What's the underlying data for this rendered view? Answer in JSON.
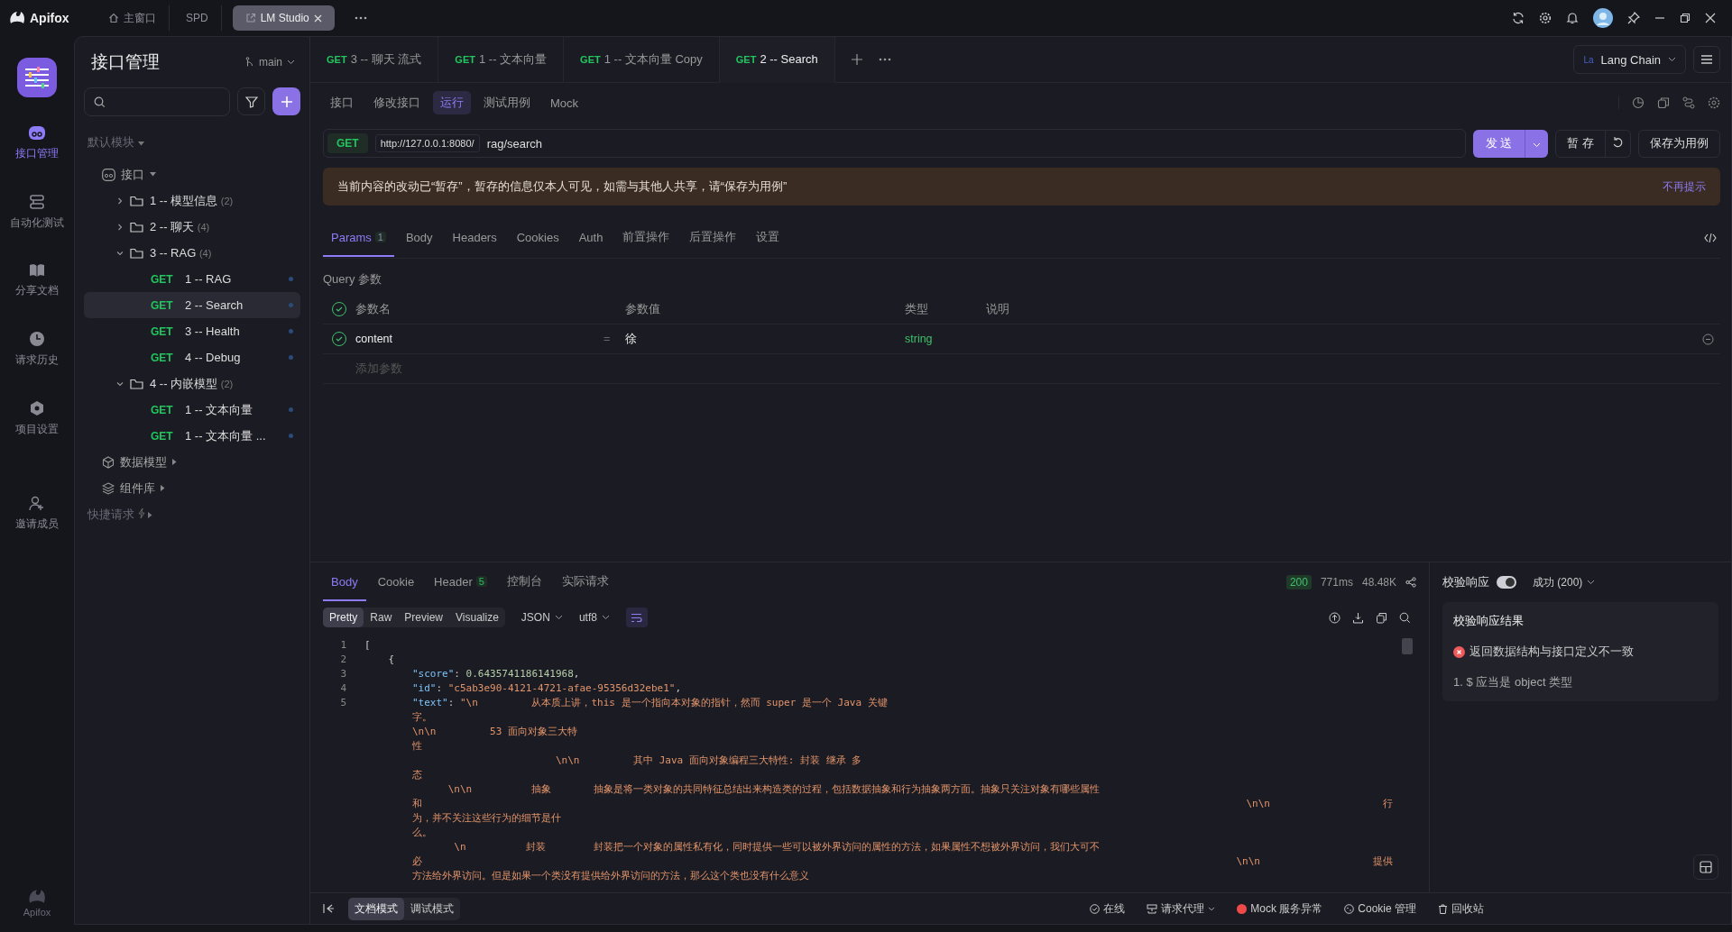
{
  "app": {
    "name": "Apifox"
  },
  "window_tabs": [
    {
      "label": "主窗口",
      "kind": "home",
      "selected": false
    },
    {
      "label": "SPD",
      "kind": "plain",
      "selected": false
    },
    {
      "label": "LM Studio",
      "kind": "external",
      "selected": true
    }
  ],
  "rail": [
    {
      "label": "接口管理",
      "kind": "api",
      "selected": true
    },
    {
      "label": "自动化测试",
      "kind": "auto",
      "selected": false
    },
    {
      "label": "分享文档",
      "kind": "book",
      "selected": false
    },
    {
      "label": "请求历史",
      "kind": "clock",
      "selected": false
    },
    {
      "label": "项目设置",
      "kind": "hex",
      "selected": false
    },
    {
      "label": "邀请成员",
      "kind": "invite",
      "selected": false
    }
  ],
  "rail_footer": "Apifox",
  "sidebar": {
    "title": "接口管理",
    "branch": "main",
    "module": "默认模块",
    "tree": [
      {
        "kind": "root",
        "label": "接口",
        "children": [
          {
            "kind": "folder",
            "label": "1 -- 模型信息",
            "count": "(2)",
            "expanded": false
          },
          {
            "kind": "folder",
            "label": "2 -- 聊天",
            "count": "(4)",
            "expanded": false
          },
          {
            "kind": "folder",
            "label": "3 -- RAG",
            "count": "(4)",
            "expanded": true,
            "children": [
              {
                "kind": "request",
                "method": "GET",
                "label": "1 -- RAG",
                "selected": false
              },
              {
                "kind": "request",
                "method": "GET",
                "label": "2 -- Search",
                "selected": true
              },
              {
                "kind": "request",
                "method": "GET",
                "label": "3 -- Health",
                "selected": false
              },
              {
                "kind": "request",
                "method": "GET",
                "label": "4 -- Debug",
                "selected": false
              }
            ]
          },
          {
            "kind": "folder",
            "label": "4 -- 内嵌模型",
            "count": "(2)",
            "expanded": true,
            "children": [
              {
                "kind": "request",
                "method": "GET",
                "label": "1 -- 文本向量",
                "selected": false
              },
              {
                "kind": "request",
                "method": "GET",
                "label": "1 -- 文本向量 ...",
                "selected": false
              }
            ]
          }
        ]
      }
    ],
    "sections": [
      {
        "label": "数据模型",
        "kind": "cube"
      },
      {
        "label": "组件库",
        "kind": "layers"
      }
    ],
    "quick": "快捷请求"
  },
  "request_tabs": [
    {
      "method": "GET",
      "label": "3 -- 聊天 流式",
      "selected": false
    },
    {
      "method": "GET",
      "label": "1 -- 文本向量",
      "selected": false
    },
    {
      "method": "GET",
      "label": "1 -- 文本向量 Copy",
      "selected": false
    },
    {
      "method": "GET",
      "label": "2 -- Search",
      "selected": true
    }
  ],
  "environment": {
    "badge": "La",
    "name": "Lang Chain"
  },
  "sub_tabs": [
    {
      "label": "接口",
      "selected": false
    },
    {
      "label": "修改接口",
      "selected": false
    },
    {
      "label": "运行",
      "selected": true
    },
    {
      "label": "测试用例",
      "selected": false
    },
    {
      "label": "Mock",
      "selected": false
    }
  ],
  "url": {
    "method": "GET",
    "base": "http://127.0.0.1:8080/",
    "path": "rag/search"
  },
  "buttons": {
    "send": "发 送",
    "save": "暂 存",
    "save_case": "保存为用例"
  },
  "notice": {
    "text": "当前内容的改动已“暂存”，暂存的信息仅本人可见，如需与其他人共享，请“保存为用例”",
    "dismiss": "不再提示"
  },
  "param_tabs": [
    {
      "label": "Params",
      "badge": "1",
      "selected": true
    },
    {
      "label": "Body",
      "selected": false
    },
    {
      "label": "Headers",
      "selected": false
    },
    {
      "label": "Cookies",
      "selected": false
    },
    {
      "label": "Auth",
      "selected": false
    },
    {
      "label": "前置操作",
      "selected": false
    },
    {
      "label": "后置操作",
      "selected": false
    },
    {
      "label": "设置",
      "selected": false
    }
  ],
  "query": {
    "title": "Query 参数",
    "all_checked": true,
    "columns": [
      "参数名",
      "参数值",
      "类型",
      "说明"
    ],
    "rows": [
      {
        "checked": true,
        "name": "content",
        "sep": "=",
        "value": "徐",
        "type": "string"
      }
    ],
    "add": "添加参数"
  },
  "response": {
    "tabs": [
      {
        "label": "Body",
        "selected": true
      },
      {
        "label": "Cookie",
        "selected": false
      },
      {
        "label": "Header",
        "badge": "5",
        "selected": false
      },
      {
        "label": "控制台",
        "selected": false
      },
      {
        "label": "实际请求",
        "selected": false
      }
    ],
    "status": "200",
    "time": "771ms",
    "size": "48.48K",
    "formats": [
      {
        "label": "Pretty",
        "selected": true
      },
      {
        "label": "Raw",
        "selected": false
      },
      {
        "label": "Preview",
        "selected": false
      },
      {
        "label": "Visualize",
        "selected": false
      }
    ],
    "language": "JSON",
    "encoding": "utf8",
    "lines": [
      {
        "number": "1",
        "segs": [
          {
            "kind": "punct",
            "text": "["
          }
        ]
      },
      {
        "number": "2",
        "segs": [
          {
            "kind": "punct",
            "text": "    {"
          }
        ]
      },
      {
        "number": "3",
        "segs": [
          {
            "kind": "key",
            "text": "        \"score\""
          },
          {
            "kind": "punct",
            "text": ": "
          },
          {
            "kind": "number",
            "text": "0.6435741186141968"
          },
          {
            "kind": "punct",
            "text": ","
          }
        ]
      },
      {
        "number": "4",
        "segs": [
          {
            "kind": "key",
            "text": "        \"id\""
          },
          {
            "kind": "punct",
            "text": ": "
          },
          {
            "kind": "string",
            "text": "\"c5ab3e90-4121-4721-afae-95356d32ebe1\""
          },
          {
            "kind": "punct",
            "text": ","
          }
        ]
      },
      {
        "number": "5",
        "segs": [
          {
            "kind": "key",
            "text": "        \"text\""
          },
          {
            "kind": "punct",
            "text": ": "
          },
          {
            "kind": "string",
            "text": "\"\\n         从本质上讲，this 是一个指向本对象的指针，然而 super 是一个 Java 关键"
          }
        ]
      },
      {
        "segs": [
          {
            "kind": "string",
            "text": "        字。"
          }
        ]
      },
      {
        "segs": [
          {
            "kind": "string",
            "text": "        \\n\\n         53 面向对象三大特"
          }
        ]
      },
      {
        "segs": [
          {
            "kind": "string",
            "text": "        性"
          }
        ]
      },
      {
        "segs": [
          {
            "kind": "string",
            "text": "                                \\n\\n         其中 Java 面向对象编程三大特性: 封装 继承 多"
          }
        ]
      },
      {
        "segs": [
          {
            "kind": "string",
            "text": "        态"
          }
        ]
      },
      {
        "segs": [
          {
            "kind": "string",
            "text": "              \\n\\n          抽象       抽象是将一类对象的共同特征总结出来构造类的过程，包括数据抽象和行为抽象两方面。抽象只关注对象有哪些属性"
          }
        ]
      },
      {
        "segs": [
          {
            "kind": "string",
            "text": "        和"
          }
        ],
        "tail": [
          "\\n\\n",
          "行"
        ]
      },
      {
        "segs": [
          {
            "kind": "string",
            "text": "        为，并不关注这些行为的细节是什"
          }
        ]
      },
      {
        "segs": [
          {
            "kind": "string",
            "text": "        么。"
          }
        ]
      },
      {
        "segs": [
          {
            "kind": "string",
            "text": "               \\n          封装        封装把一个对象的属性私有化，同时提供一些可以被外界访问的属性的方法，如果属性不想被外界访问，我们大可不"
          }
        ]
      },
      {
        "segs": [
          {
            "kind": "string",
            "text": "        必"
          }
        ],
        "tail": [
          "\\n\\n",
          "提供"
        ]
      },
      {
        "segs": [
          {
            "kind": "string",
            "text": "        方法给外界访问。但是如果一个类没有提供给外界访问的方法，那么这个类也没有什么意义"
          }
        ]
      }
    ]
  },
  "validation": {
    "label": "校验响应",
    "on": true,
    "status": "成功 (200)",
    "title": "校验响应结果",
    "error": "返回数据结构与接口定义不一致",
    "detail": "1. $ 应当是 object 类型"
  },
  "footer": {
    "modes": [
      {
        "label": "文档模式",
        "selected": true
      },
      {
        "label": "调试模式",
        "selected": false
      }
    ],
    "status": [
      {
        "label": "在线",
        "kind": "check"
      },
      {
        "label": "请求代理",
        "kind": "proxy"
      },
      {
        "label": "Mock 服务异常",
        "kind": "error"
      },
      {
        "label": "Cookie 管理",
        "kind": "cookie"
      },
      {
        "label": "回收站",
        "kind": "trash"
      }
    ]
  }
}
